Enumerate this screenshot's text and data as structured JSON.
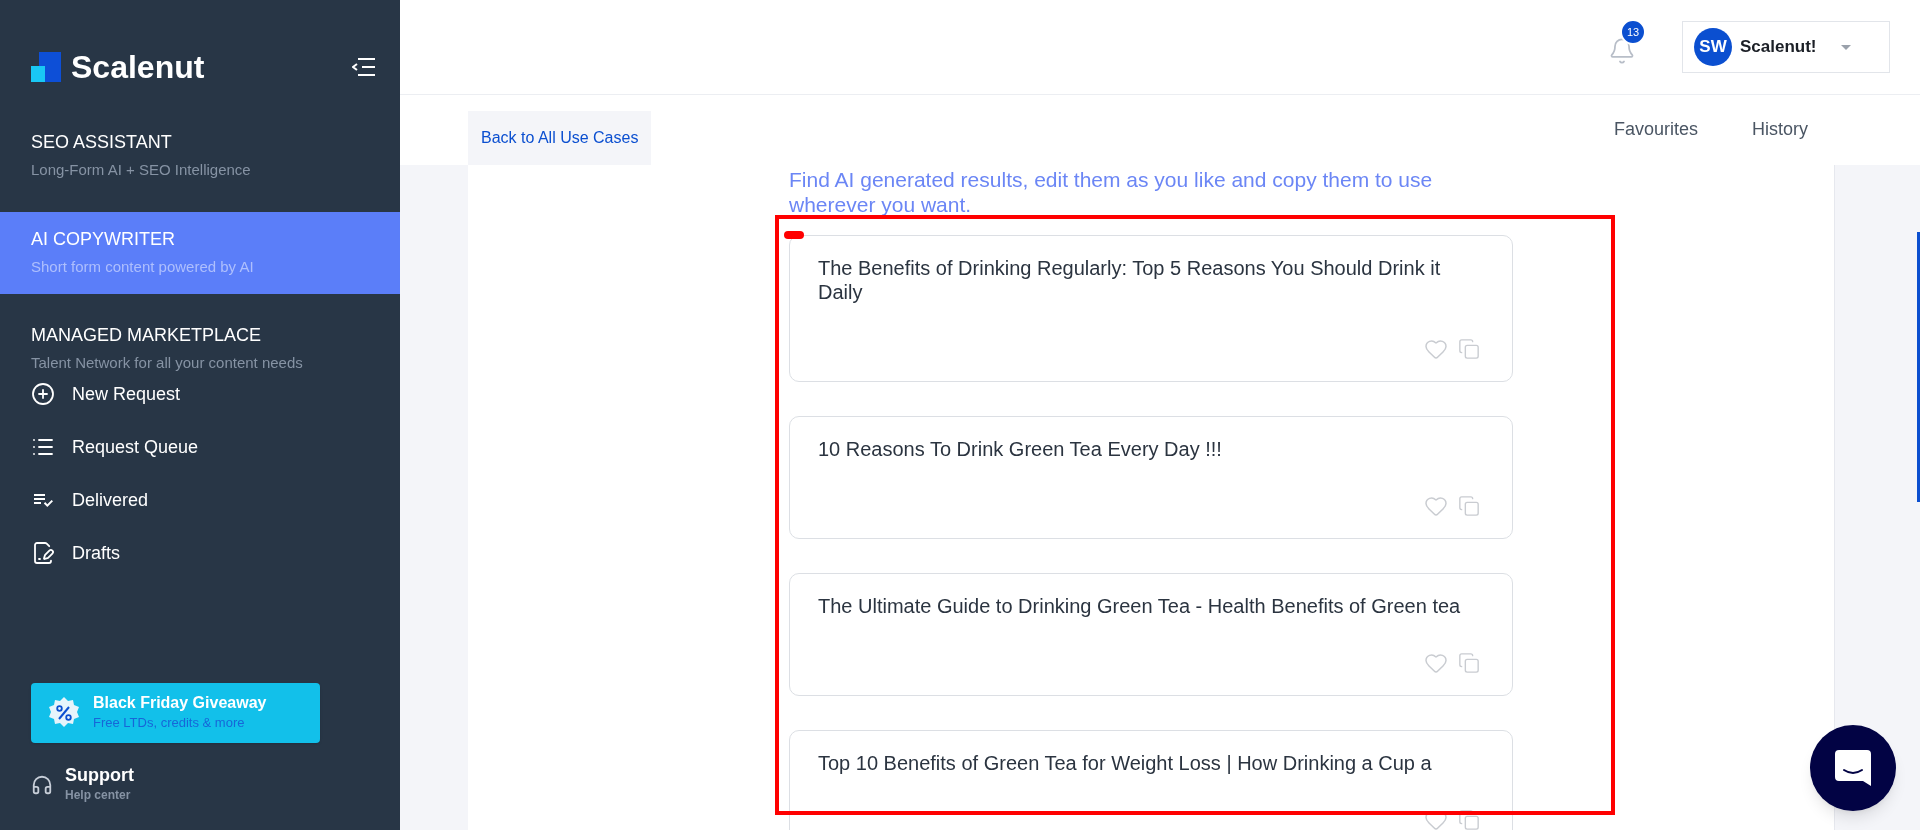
{
  "sidebar": {
    "logo": "Scalenut",
    "sections": [
      {
        "title": "SEO ASSISTANT",
        "subtitle": "Long-Form AI + SEO Intelligence",
        "selected": false
      },
      {
        "title": "AI COPYWRITER",
        "subtitle": "Short form content powered by AI",
        "selected": true
      },
      {
        "title": "MANAGED MARKETPLACE",
        "subtitle": "Talent Network for all your content needs",
        "selected": false
      }
    ],
    "items": [
      {
        "label": "New Request",
        "kind": "add"
      },
      {
        "label": "Request Queue",
        "kind": "list"
      },
      {
        "label": "Delivered",
        "kind": "delivered"
      },
      {
        "label": "Drafts",
        "kind": "drafts"
      }
    ],
    "promo": {
      "title": "Black Friday Giveaway",
      "subtitle": "Free LTDs, credits & more"
    },
    "support": {
      "title": "Support",
      "subtitle": "Help center"
    }
  },
  "header": {
    "notifications": "13",
    "user": {
      "initials": "SW",
      "name": "Scalenut!"
    }
  },
  "back_link": "Back to All Use Cases",
  "tabs": [
    {
      "label": "Favourites",
      "selected": false
    },
    {
      "label": "History",
      "selected": false
    }
  ],
  "intro": "Find AI generated results, edit them as you like and copy them to use wherever you want.",
  "results": [
    {
      "text": "The Benefits of Drinking Regularly: Top 5 Reasons You Should Drink it Daily",
      "favourite": false
    },
    {
      "text": "10 Reasons To Drink Green Tea Every Day !!!",
      "favourite": false
    },
    {
      "text": "The Ultimate Guide to Drinking Green Tea - Health Benefits of Green tea",
      "favourite": false
    },
    {
      "text": "Top 10 Benefits of Green Tea for Weight Loss | How Drinking a Cup a",
      "favourite": false
    }
  ]
}
